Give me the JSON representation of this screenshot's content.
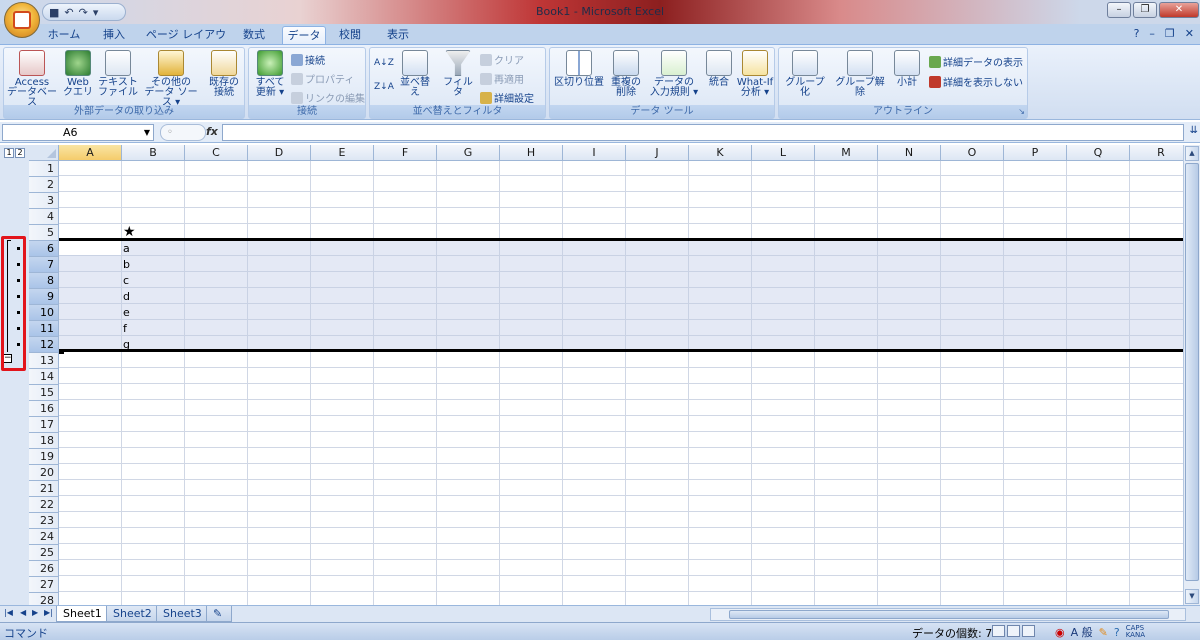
{
  "app": {
    "window_title": "Book1 - Microsoft Excel"
  },
  "qat": {
    "save_icon": "save-icon",
    "undo_icon": "undo-icon",
    "redo_icon": "redo-icon",
    "customize_icon": "chevron-down-icon"
  },
  "tabs": [
    "ホーム",
    "挿入",
    "ページ レイアウト",
    "数式",
    "データ",
    "校閲",
    "表示"
  ],
  "active_tab": "データ",
  "ribbon": {
    "groups": {
      "external": "外部データの取り込み",
      "connections": "接続",
      "sort_filter": "並べ替えとフィルタ",
      "data_tools": "データ ツール",
      "outline": "アウトライン"
    },
    "buttons": {
      "access_1": "Access",
      "access_2": "データベース",
      "web_1": "Web",
      "web_2": "クエリ",
      "text_1": "テキスト",
      "text_2": "ファイル",
      "other_1": "その他の",
      "other_2": "データ ソース ▾",
      "existing_1": "既存の",
      "existing_2": "接続",
      "refresh_1": "すべて",
      "refresh_2": "更新 ▾",
      "connections": "接続",
      "properties": "プロパティ",
      "edit_links": "リンクの編集",
      "sort_az": "A↓Z",
      "sort_za": "Z↓A",
      "sort": "並べ替え",
      "filter": "フィルタ",
      "clear": "クリア",
      "reapply": "再適用",
      "advanced": "詳細設定",
      "text_to_columns": "区切り位置",
      "remove_dup_1": "重複の",
      "remove_dup_2": "削除",
      "validation_1": "データの",
      "validation_2": "入力規則 ▾",
      "consolidate": "統合",
      "whatif_1": "What-If",
      "whatif_2": "分析 ▾",
      "group": "グループ化",
      "ungroup": "グループ解除",
      "subtotal": "小計",
      "show_detail": "詳細データの表示",
      "hide_detail": "詳細を表示しない"
    }
  },
  "formula_bar": {
    "name_box": "A6",
    "fx": "fx",
    "formula": ""
  },
  "outline": {
    "levels": [
      "1",
      "2"
    ],
    "collapse_symbol": "−"
  },
  "columns": [
    "A",
    "B",
    "C",
    "D",
    "E",
    "F",
    "G",
    "H",
    "I",
    "J",
    "K",
    "L",
    "M",
    "N",
    "O",
    "P",
    "Q",
    "R"
  ],
  "rows": [
    "1",
    "2",
    "3",
    "4",
    "5",
    "6",
    "7",
    "8",
    "9",
    "10",
    "11",
    "12",
    "13",
    "14",
    "15",
    "16",
    "17",
    "18",
    "19",
    "20",
    "21",
    "22",
    "23",
    "24",
    "25",
    "26",
    "27",
    "28"
  ],
  "cells": {
    "B5": "★",
    "B6": "a",
    "B7": "b",
    "B8": "c",
    "B9": "d",
    "B10": "e",
    "B11": "f",
    "B12": "g"
  },
  "sheets": [
    "Sheet1",
    "Sheet2",
    "Sheet3"
  ],
  "active_sheet": "Sheet1",
  "status": {
    "mode": "コマンド",
    "count": "データの個数: 7"
  },
  "taskbar": {
    "ime": "A 般",
    "caps": "CAPS",
    "kana": "KANA"
  }
}
